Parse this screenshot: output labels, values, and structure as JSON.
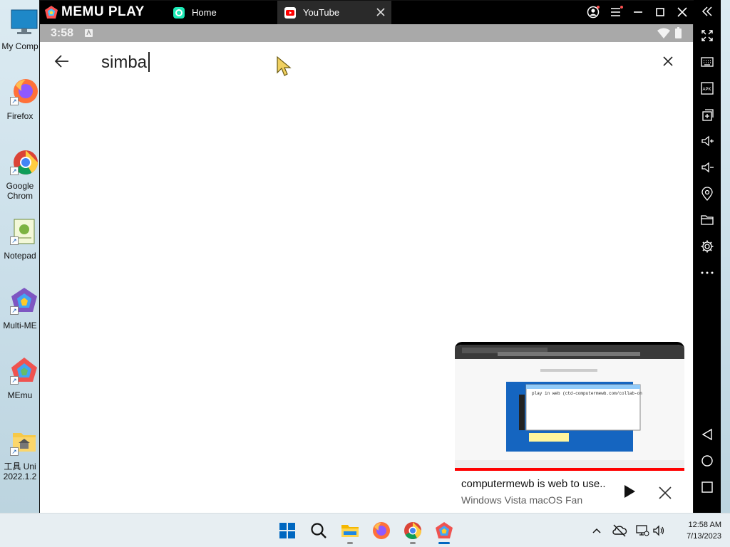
{
  "desktop": {
    "icons": [
      {
        "label": "My Comp"
      },
      {
        "label": "Firefox"
      },
      {
        "label": "Google Chrom"
      },
      {
        "label": "Notepad"
      },
      {
        "label": "Multi-ME"
      },
      {
        "label": "MEmu"
      },
      {
        "label": "工具 Uni 2022.1.2"
      }
    ]
  },
  "emulator": {
    "logo_text": "MEMU PLAY",
    "tabs": [
      {
        "label": "Home"
      },
      {
        "label": "YouTube"
      }
    ],
    "status_time": "3:58",
    "search": {
      "value": "simba"
    },
    "mini_player": {
      "title": "computermewb is web to use..",
      "channel": "Windows Vista macOS Fan",
      "thumb_text": "play in web (ctd-computermewb.com/collab-on"
    }
  },
  "taskbar": {
    "time": "12:58 AM",
    "date": "7/13/2023"
  },
  "colors": {
    "accent_red": "#ff0000",
    "windows_blue": "#0067c0",
    "memu_black": "#000000"
  }
}
